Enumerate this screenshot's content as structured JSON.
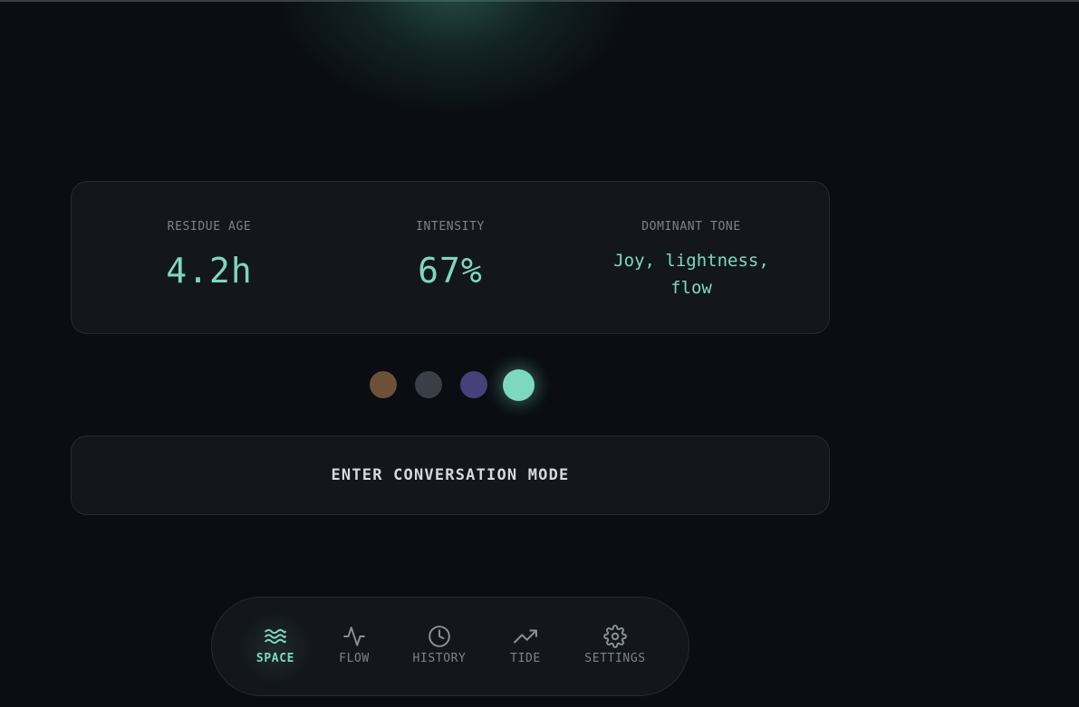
{
  "stats": {
    "residue_age": {
      "label": "RESIDUE AGE",
      "value": "4.2h"
    },
    "intensity": {
      "label": "INTENSITY",
      "value": "67%"
    },
    "dominant_tone": {
      "label": "DOMINANT TONE",
      "value": "Joy, lightness, flow"
    }
  },
  "swatches": [
    {
      "color": "#6e5038",
      "selected": false
    },
    {
      "color": "#3a3f47",
      "selected": false
    },
    {
      "color": "#47407a",
      "selected": false
    },
    {
      "color": "#7dd8c0",
      "selected": true
    }
  ],
  "cta": {
    "label": "ENTER CONVERSATION MODE"
  },
  "nav": {
    "items": [
      {
        "label": "SPACE",
        "icon": "waves-icon",
        "active": true
      },
      {
        "label": "FLOW",
        "icon": "activity-icon",
        "active": false
      },
      {
        "label": "HISTORY",
        "icon": "clock-icon",
        "active": false
      },
      {
        "label": "TIDE",
        "icon": "trending-up-icon",
        "active": false
      },
      {
        "label": "SETTINGS",
        "icon": "gear-icon",
        "active": false
      }
    ]
  },
  "colors": {
    "accent": "#7dd8c0",
    "background": "#0a0d11",
    "card": "#13171b",
    "muted": "#7c838b"
  }
}
